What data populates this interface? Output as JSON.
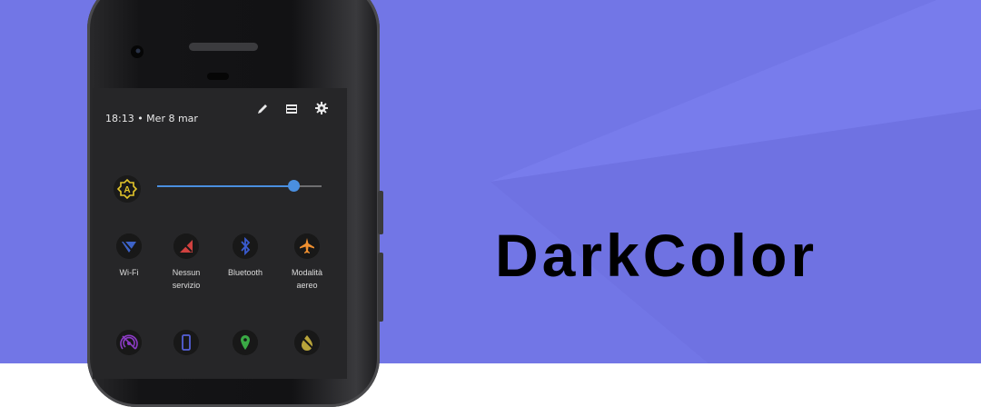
{
  "background": {
    "color": "#7276E6",
    "shade_light": "#7E82F0",
    "shade_dark": "#6A6DDC"
  },
  "status": {
    "time_date": "18:13 • Mer 8 mar"
  },
  "toolbar": {
    "edit_icon": "pencil-icon",
    "list_icon": "list-icon",
    "settings_icon": "gear-icon"
  },
  "brightness": {
    "icon": "auto-brightness-icon",
    "icon_color": "#E3C52A",
    "accent": "#4A8FE0",
    "level": 0.83
  },
  "tiles_row1": [
    {
      "label": "Wi-Fi",
      "icon": "wifi-off-icon",
      "color": "#3D63C8"
    },
    {
      "label": "Nessun servizio",
      "icon": "no-signal-icon",
      "color": "#D0413F"
    },
    {
      "label": "Bluetooth",
      "icon": "bluetooth-icon",
      "color": "#3A5BD0"
    },
    {
      "label": "Modalità aereo",
      "icon": "airplane-icon",
      "color": "#F09030"
    }
  ],
  "tiles_row2": [
    {
      "icon": "hotspot-icon",
      "color": "#8B3BC4"
    },
    {
      "icon": "phone-rotate-icon",
      "color": "#5560D8"
    },
    {
      "icon": "location-icon",
      "color": "#3AAA45"
    },
    {
      "icon": "invert-colors-icon",
      "color": "#B8A43A"
    }
  ],
  "brand": {
    "name": "DarkColor"
  }
}
